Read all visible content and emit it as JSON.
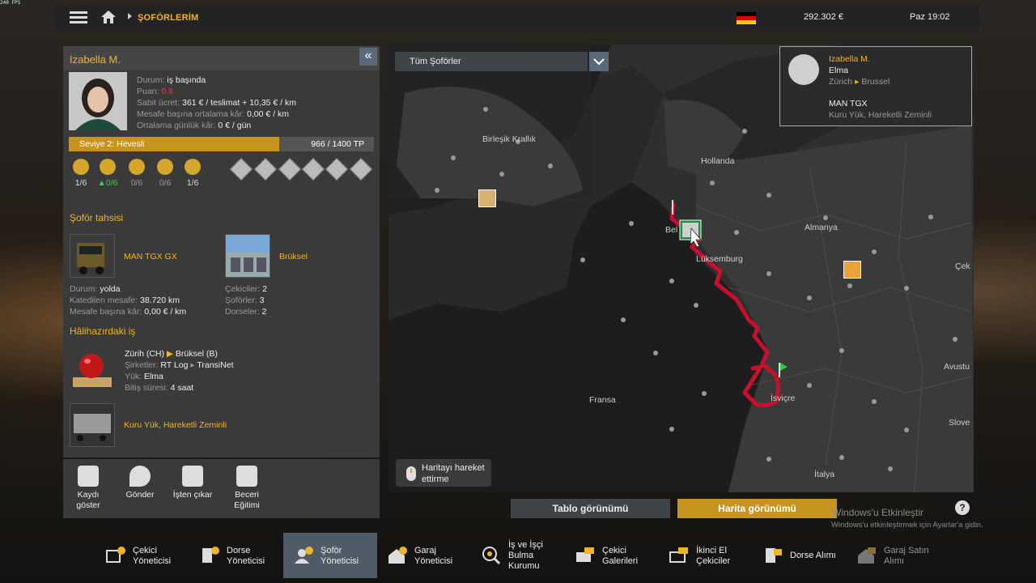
{
  "fps": "240 FPS",
  "topbar": {
    "breadcrumb": "ŞOFÖRLERİM",
    "money": "292.302 €",
    "time": "Paz 19:02",
    "flag_colors": [
      "#000000",
      "#dd0000",
      "#ffce00"
    ]
  },
  "driver": {
    "name": "Izabella M.",
    "lines": [
      {
        "label": "Durum:",
        "value": "iş başında",
        "color": "#eeeeee"
      },
      {
        "label": "Puan:",
        "value": "0.8",
        "color": "#e04040"
      },
      {
        "label": "Sabit ücret:",
        "value": "361 € / teslimat + 10,35 € / km",
        "color": "#eeeeee"
      },
      {
        "label": "Mesafe başına ortalama kâr:",
        "value": "0,00 € / km",
        "color": "#eeeeee"
      },
      {
        "label": "Ortalama günlük kâr:",
        "value": "0 € / gün",
        "color": "#eeeeee"
      }
    ],
    "level_label": "Seviye 2: Hevesli",
    "tp": "966 / 1400 TP",
    "level_progress": 0.69,
    "skills": [
      {
        "icon": "adr-pin-icon",
        "value": "1/6"
      },
      {
        "icon": "long-distance-icon",
        "value": "0/6"
      },
      {
        "icon": "high-value-cargo-icon",
        "value": "0/6"
      },
      {
        "icon": "fragile-cargo-icon",
        "value": "0/6"
      },
      {
        "icon": "just-in-time-icon",
        "value": "1/6"
      }
    ],
    "adr_icons": [
      "explosives-icon",
      "gases-icon",
      "flammable-liquids-icon",
      "flammable-solids-icon",
      "toxic-icon",
      "corrosive-icon"
    ]
  },
  "assignment": {
    "title": "Şoför tahsisi",
    "truck": "MAN TGX GX",
    "garage": "Brüksel",
    "truck_stats": [
      {
        "label": "Durum:",
        "value": "yolda"
      },
      {
        "label": "Katedilen mesafe:",
        "value": "38.720 km"
      },
      {
        "label": "Mesafe başına kâr:",
        "value": "0,00 € / km"
      }
    ],
    "garage_stats": [
      {
        "label": "Çekiciler:",
        "value": "2"
      },
      {
        "label": "Şoförler:",
        "value": "3"
      },
      {
        "label": "Dorseler:",
        "value": "2"
      }
    ]
  },
  "current_job": {
    "title": "Hâlihazırdaki iş",
    "route_from": "Zürih (CH)",
    "route_to": "Brüksel (B)",
    "companies_label": "Şirketler:",
    "company_from": "RT Log",
    "company_to": "TransiNet",
    "cargo_label": "Yük:",
    "cargo": "Elma",
    "finish_label": "Bitiş süresi:",
    "finish": "4 saat",
    "trailer": "Kuru Yük, Hareketli Zeminli"
  },
  "actions": [
    {
      "icon": "record-icon",
      "label": "Kaydı göster"
    },
    {
      "icon": "send-location-icon",
      "label": "Gönder"
    },
    {
      "icon": "fire-driver-icon",
      "label": "İşten çıkar"
    },
    {
      "icon": "skill-training-icon",
      "label": "Beceri Eğitimi"
    }
  ],
  "map": {
    "driver_filter": "Tüm Şoförler",
    "labels": [
      "Birleşik Krallık",
      "Hollanda",
      "Almanya",
      "Belçika",
      "Lüksemburg",
      "Fransa",
      "İsviçre",
      "Avustu",
      "Slove",
      "İtalya",
      "Çek"
    ],
    "card": {
      "name": "Izabella M.",
      "cargo": "Elma",
      "from": "Zürich",
      "to": "Brussel",
      "truck": "MAN TGX",
      "trailer": "Kuru Yük, Hareketli Zeminli"
    },
    "pan_hint": "Haritayı hareket ettirme",
    "route_color": "#c8102e"
  },
  "views": {
    "table": "Tablo görünümü",
    "map": "Harita görünümü"
  },
  "watermark": {
    "line1": "Windows'u Etkinleştir",
    "line2": "Windows'u etkinleştirmek için Ayarlar'a gidin."
  },
  "tabs": [
    {
      "icon": "truck-manager-icon",
      "label": "Çekici Yöneticisi"
    },
    {
      "icon": "trailer-manager-icon",
      "label": "Dorse Yöneticisi"
    },
    {
      "icon": "driver-manager-icon",
      "label": "Şoför Yöneticisi"
    },
    {
      "icon": "garage-manager-icon",
      "label": "Garaj Yöneticisi"
    },
    {
      "icon": "recruitment-icon",
      "label": "İş ve İşçi Bulma Kurumu"
    },
    {
      "icon": "truck-dealer-icon",
      "label": "Çekici Galerileri"
    },
    {
      "icon": "used-truck-icon",
      "label": "İkinci El Çekiciler"
    },
    {
      "icon": "trailer-purchase-icon",
      "label": "Dorse Alımı"
    },
    {
      "icon": "garage-purchase-icon",
      "label": "Garaj Satın Alımı"
    }
  ]
}
